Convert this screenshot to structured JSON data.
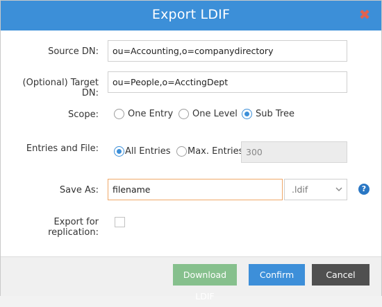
{
  "dialog": {
    "title": "Export LDIF",
    "close_symbol": "✖"
  },
  "source_dn": {
    "label": "Source DN:",
    "value": "ou=Accounting,o=companydirectory"
  },
  "target_dn": {
    "label": "(Optional) Target DN:",
    "value": "ou=People,o=AcctingDept"
  },
  "scope": {
    "label": "Scope:",
    "options": [
      "One Entry",
      "One Level",
      "Sub Tree"
    ],
    "selected": "Sub Tree"
  },
  "entries": {
    "label": "Entries and File:",
    "options": [
      "All Entries",
      "Max. Entries"
    ],
    "selected": "All Entries",
    "max_value": "300"
  },
  "save_as": {
    "label": "Save As:",
    "filename": "filename",
    "extension": ".ldif",
    "help_symbol": "?"
  },
  "replication": {
    "label": "Export for replication:",
    "checked": false
  },
  "buttons": {
    "download": "Download LDIF",
    "confirm": "Confirm",
    "cancel": "Cancel"
  },
  "colors": {
    "title_bar": "#3c8fd8",
    "close_icon": "#e0624e",
    "download_button": "#86c08d",
    "confirm_button": "#3d8fd9",
    "cancel_button": "#505050",
    "focus_border": "#f0a868"
  }
}
